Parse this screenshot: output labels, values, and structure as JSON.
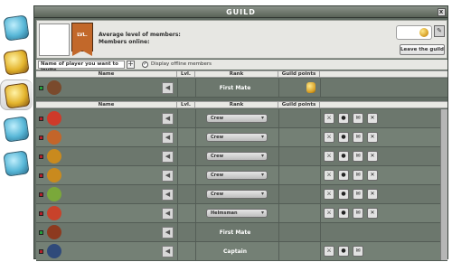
{
  "window": {
    "title": "Guild",
    "close_label": "x"
  },
  "header": {
    "level_label": "LVL.",
    "avg_level_label": "Average level of members:",
    "members_online_label": "Members online:",
    "edit_label": "✎",
    "leave_label": "Leave the guild"
  },
  "invite": {
    "placeholder": "Name of player you want to invite",
    "plus_label": "+",
    "display_offline_label": "Display offline members",
    "display_offline_checked": true
  },
  "columns": {
    "name": "Name",
    "level": "Lvl.",
    "rank": "Rank",
    "points": "Guild points"
  },
  "side_tabs": [
    {
      "icon": "crystal-house-icon",
      "active": false
    },
    {
      "icon": "gold-coins-icon",
      "active": false
    },
    {
      "icon": "treasure-chest-icon",
      "active": true
    },
    {
      "icon": "crystal-book-icon",
      "active": false
    },
    {
      "icon": "crystal-map-icon",
      "active": false
    }
  ],
  "colors": {
    "status_online": "#23a13a",
    "status_offline": "#b51f2a",
    "avatar_palette": [
      "#7a4a2c",
      "#cf3a2a",
      "#c3652a",
      "#c98a1e",
      "#c98a1e",
      "#7aa83a",
      "#c8422b",
      "#8d3a1f",
      "#2f4a7a"
    ]
  },
  "leader_row": {
    "status": "online",
    "avatar": "avatar-boy-brown-hair",
    "rank": "First Mate",
    "has_points_icon": true
  },
  "members": [
    {
      "status": "offline",
      "avatar": "avatar-red-pirate",
      "rank": "Crew",
      "editable": true,
      "actions": [
        "pvp",
        "group",
        "chat",
        "kick"
      ]
    },
    {
      "status": "offline",
      "avatar": "avatar-orange-hat",
      "rank": "Crew",
      "editable": true,
      "actions": [
        "pvp",
        "group",
        "chat",
        "kick"
      ]
    },
    {
      "status": "offline",
      "avatar": "avatar-orange-bandana",
      "rank": "Crew",
      "editable": true,
      "actions": [
        "pvp",
        "group",
        "chat",
        "kick"
      ]
    },
    {
      "status": "offline",
      "avatar": "avatar-yellow-hair",
      "rank": "Crew",
      "editable": true,
      "actions": [
        "pvp",
        "group",
        "chat",
        "kick"
      ]
    },
    {
      "status": "offline",
      "avatar": "avatar-green-creature",
      "rank": "Crew",
      "editable": true,
      "actions": [
        "pvp",
        "group",
        "chat",
        "kick"
      ]
    },
    {
      "status": "offline",
      "avatar": "avatar-red-bandana",
      "rank": "Helmsman",
      "editable": true,
      "actions": [
        "pvp",
        "group",
        "chat",
        "kick"
      ]
    },
    {
      "status": "online",
      "avatar": "avatar-brown-hair",
      "rank": "First Mate",
      "editable": false,
      "actions": []
    },
    {
      "status": "offline",
      "avatar": "avatar-dark-hood",
      "rank": "Captain",
      "editable": false,
      "actions": [
        "pvp",
        "group",
        "chat"
      ]
    }
  ]
}
